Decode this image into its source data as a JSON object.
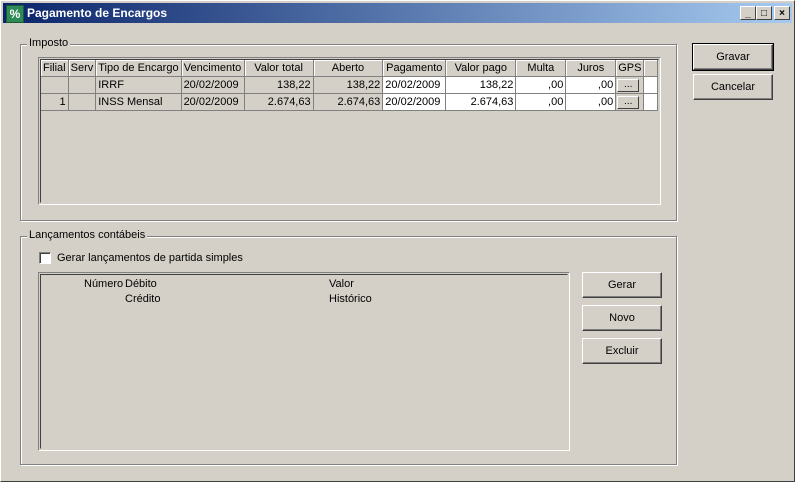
{
  "window": {
    "title": "Pagamento de Encargos"
  },
  "imposto": {
    "label": "Imposto",
    "columns": [
      "Filial",
      "Serv",
      "Tipo de Encargo",
      "Vencimento",
      "Valor total",
      "Aberto",
      "Pagamento",
      "Valor pago",
      "Multa",
      "Juros",
      "GPS"
    ],
    "rows": [
      {
        "filial": "",
        "serv": "",
        "tipo": "IRRF",
        "vencimento": "20/02/2009",
        "valor_total": "138,22",
        "aberto": "138,22",
        "pagamento": "20/02/2009",
        "valor_pago": "138,22",
        "multa": ",00",
        "juros": ",00",
        "gps": "..."
      },
      {
        "filial": "1",
        "serv": "",
        "tipo": "INSS Mensal",
        "vencimento": "20/02/2009",
        "valor_total": "2.674,63",
        "aberto": "2.674,63",
        "pagamento": "20/02/2009",
        "valor_pago": "2.674,63",
        "multa": ",00",
        "juros": ",00",
        "gps": "..."
      }
    ]
  },
  "actions": {
    "gravar": "Gravar",
    "cancelar": "Cancelar"
  },
  "lancamentos": {
    "label": "Lançamentos contábeis",
    "checkbox_label": "Gerar lançamentos de partida simples",
    "checkbox_checked": false,
    "headers": {
      "numero": "Número",
      "debito": "Débito",
      "valor": "Valor",
      "credito": "Crédito",
      "historico": "Histórico"
    },
    "buttons": {
      "gerar": "Gerar",
      "novo": "Novo",
      "excluir": "Excluir"
    }
  }
}
